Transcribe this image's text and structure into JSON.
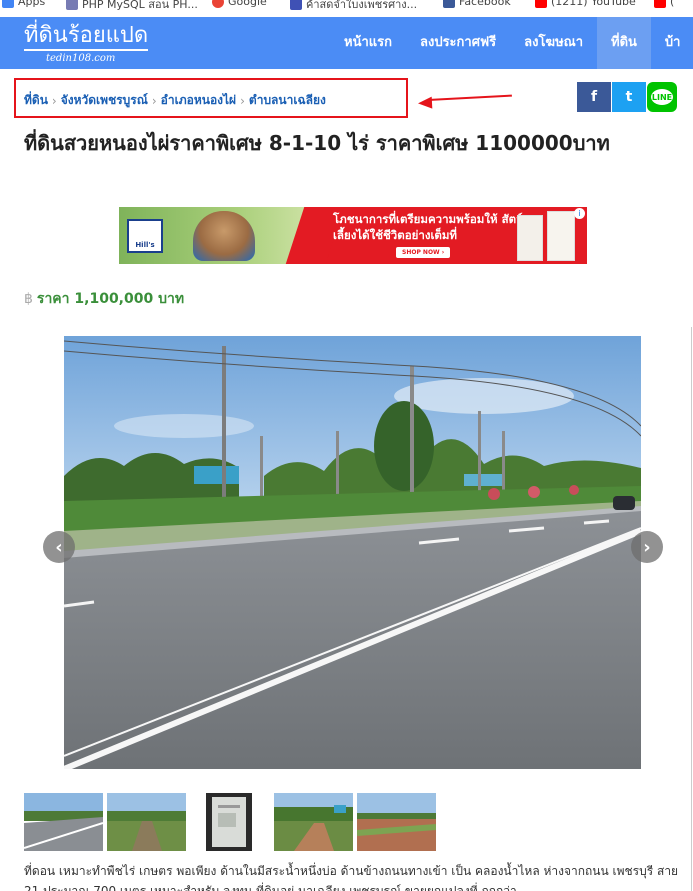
{
  "bookmarks": [
    {
      "label": "Apps",
      "icon": "apps-icon",
      "color": "#4285f4"
    },
    {
      "label": "PHP MySQL สอน PH...",
      "icon": "php-icon",
      "color": "#777bb3"
    },
    {
      "label": "Google",
      "icon": "google-icon",
      "color": "#ea4335"
    },
    {
      "label": "ค้าสดจำใบงเพชรศาง...",
      "icon": "bookmark-icon",
      "color": "#3f51b5"
    },
    {
      "label": "Facebook",
      "icon": "facebook-icon",
      "color": "#3b5998"
    },
    {
      "label": "(1211) YouTube",
      "icon": "youtube-icon",
      "color": "#ff0000"
    },
    {
      "label": "(",
      "icon": "youtube-icon",
      "color": "#ff0000"
    }
  ],
  "site": {
    "logo_text": "ที่ดินร้อยแปด",
    "logo_sub": "tedin108.com",
    "nav": [
      {
        "label": "หน้าแรก",
        "active": false
      },
      {
        "label": "ลงประกาศฟรี",
        "active": false
      },
      {
        "label": "ลงโฆษณา",
        "active": false
      },
      {
        "label": "ที่ดิน",
        "active": true
      },
      {
        "label": "บ้า",
        "active": false
      }
    ]
  },
  "breadcrumb": [
    "ที่ดิน",
    "จังหวัดเพชรบูรณ์",
    "อำเภอหนองไผ่",
    "ตำบลนาเฉลียง"
  ],
  "share": {
    "facebook": "f",
    "twitter": "t",
    "line": "LINE"
  },
  "listing": {
    "title": "ที่ดินสวยหนองไผ่ราคาพิเศษ 8-1-10 ไร่ ราคาพิเศษ 1100000บาท",
    "price_symbol": "฿",
    "price_text": "ราคา 1,100,000 บาท",
    "description": "ที่ดอน เหมาะทำพืชไร่ เกษตร พอเพียง ด้านในมีสระน้ำหนึ่งบ่อ ด้านข้างถนนทางเข้า เป็น คลองน้ำไหล ห่างจากถนน เพชรบุรี สาย 21 ประมาณ 700 เมตร เหมาะสำหรับ ลงทุน ที่ดินอยู่ นาเฉลียง เพชรบูรณ์ ขายยกแปลงที่ ถูกกว่า"
  },
  "ad": {
    "brand": "Hill's",
    "headline": "โภชนาการที่เตรียมความพร้อมให้ สัตว์เลี้ยงได้ใช้ชีวิตอย่างเต็มที่",
    "cta": "SHOP NOW ›",
    "info": "i"
  },
  "carousel": {
    "prev": "‹",
    "next": "›"
  },
  "colors": {
    "nav_bg": "#4b8cf5",
    "nav_active": "#6c9ff2",
    "highlight": "#e5141b",
    "link": "#1a5fb4",
    "price": "#3a8f3a"
  }
}
